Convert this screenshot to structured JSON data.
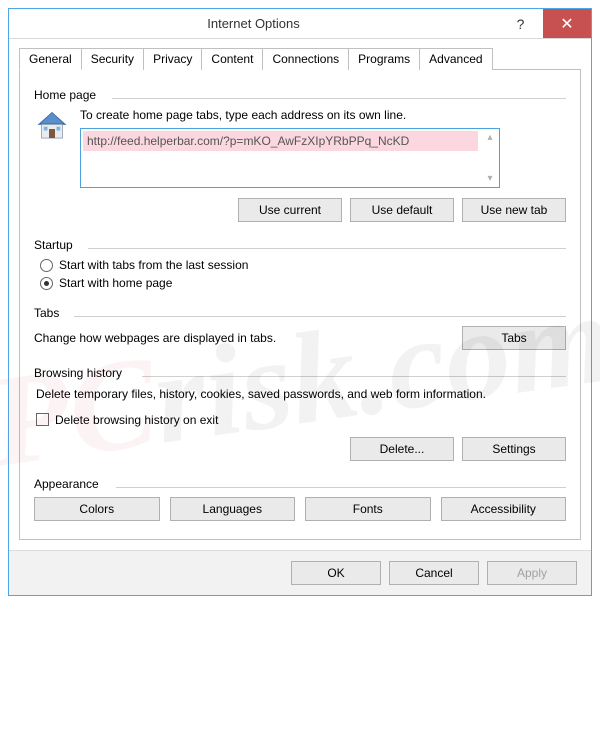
{
  "titlebar": {
    "title": "Internet Options"
  },
  "tabs": [
    "General",
    "Security",
    "Privacy",
    "Content",
    "Connections",
    "Programs",
    "Advanced"
  ],
  "homepage": {
    "legend": "Home page",
    "description": "To create home page tabs, type each address on its own line.",
    "url": "http://feed.helperbar.com/?p=mKO_AwFzXIpYRbPPq_NcKD",
    "use_current": "Use current",
    "use_default": "Use default",
    "use_new_tab": "Use new tab"
  },
  "startup": {
    "legend": "Startup",
    "option1": "Start with tabs from the last session",
    "option2": "Start with home page",
    "selected": 2
  },
  "tabs_section": {
    "legend": "Tabs",
    "description": "Change how webpages are displayed in tabs.",
    "button": "Tabs"
  },
  "history": {
    "legend": "Browsing history",
    "description": "Delete temporary files, history, cookies, saved passwords, and web form information.",
    "checkbox": "Delete browsing history on exit",
    "delete": "Delete...",
    "settings": "Settings"
  },
  "appearance": {
    "legend": "Appearance",
    "colors": "Colors",
    "languages": "Languages",
    "fonts": "Fonts",
    "accessibility": "Accessibility"
  },
  "dialog": {
    "ok": "OK",
    "cancel": "Cancel",
    "apply": "Apply"
  }
}
